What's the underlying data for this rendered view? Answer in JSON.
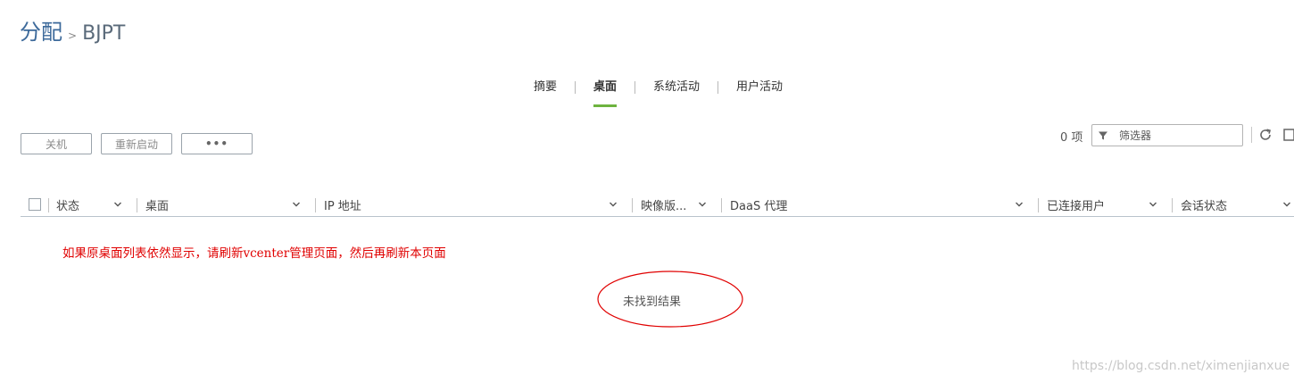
{
  "breadcrumb": {
    "root": "分配",
    "separator": ">",
    "current": "BJPT"
  },
  "tabs": [
    {
      "label": "摘要",
      "active": false
    },
    {
      "label": "桌面",
      "active": true
    },
    {
      "label": "系统活动",
      "active": false
    },
    {
      "label": "用户活动",
      "active": false
    }
  ],
  "toolbar": {
    "shutdown_label": "关机",
    "restart_label": "重新启动",
    "more_label": "•••"
  },
  "list_controls": {
    "item_count": "0 项",
    "filter_placeholder": "筛选器"
  },
  "table": {
    "columns": [
      {
        "label": "状态"
      },
      {
        "label": "桌面"
      },
      {
        "label": "IP 地址"
      },
      {
        "label": "映像版..."
      },
      {
        "label": "DaaS 代理"
      },
      {
        "label": "已连接用户"
      },
      {
        "label": "会话状态"
      }
    ],
    "empty_message": "未找到结果"
  },
  "annotation": {
    "text": "如果原桌面列表依然显示，请刷新vcenter管理页面，然后再刷新本页面",
    "color": "#e00000"
  },
  "watermark": "https://blog.csdn.net/ximenjianxue",
  "colors": {
    "accent_tab": "#6db33f",
    "title_blue": "#3d6a9b"
  }
}
